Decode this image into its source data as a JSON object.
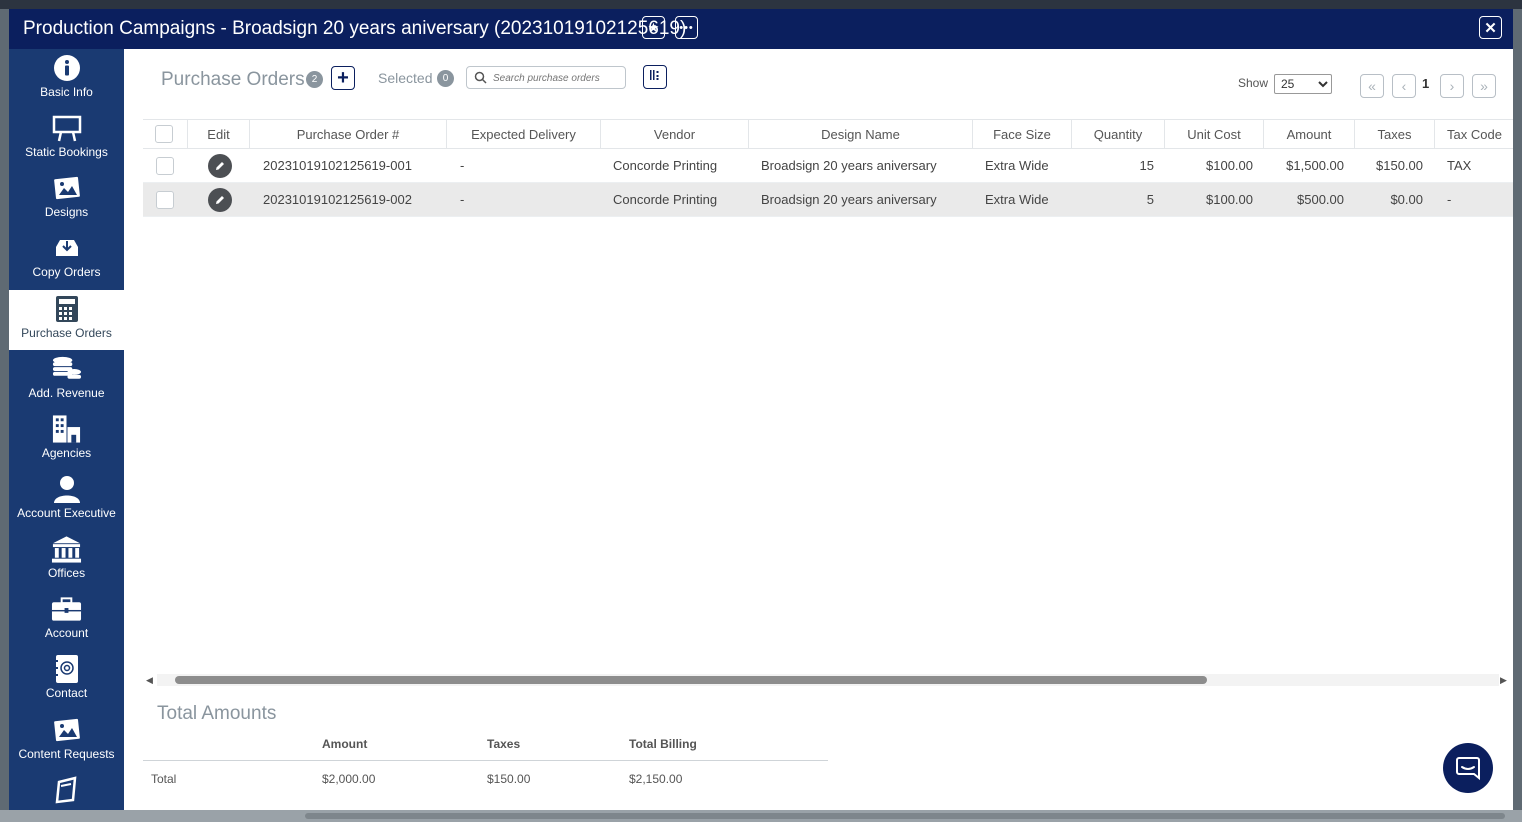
{
  "window": {
    "title": "Production Campaigns - Broadsign 20 years aniversary (20231019102125619)",
    "star_icon": "star-icon",
    "more_icon": "more-icon",
    "close_icon": "close-icon"
  },
  "sidebar": {
    "items": [
      {
        "label": "Basic Info",
        "icon": "info-icon",
        "active": false
      },
      {
        "label": "Static Bookings",
        "icon": "billboard-icon",
        "active": false
      },
      {
        "label": "Designs",
        "icon": "image-icon",
        "active": false
      },
      {
        "label": "Copy Orders",
        "icon": "inbox-download-icon",
        "active": false
      },
      {
        "label": "Purchase Orders",
        "icon": "calculator-icon",
        "active": true
      },
      {
        "label": "Add. Revenue",
        "icon": "coins-icon",
        "active": false
      },
      {
        "label": "Agencies",
        "icon": "building-icon",
        "active": false
      },
      {
        "label": "Account Executive",
        "icon": "user-icon",
        "active": false
      },
      {
        "label": "Offices",
        "icon": "bank-icon",
        "active": false
      },
      {
        "label": "Account",
        "icon": "briefcase-icon",
        "active": false
      },
      {
        "label": "Contact",
        "icon": "address-book-icon",
        "active": false
      },
      {
        "label": "Content Requests",
        "icon": "image-request-icon",
        "active": false
      },
      {
        "label": "",
        "icon": "document-icon",
        "active": false
      }
    ]
  },
  "toolbar": {
    "title": "Purchase Orders",
    "count": "2",
    "selected_label": "Selected",
    "selected_count": "0",
    "search_placeholder": "Search purchase orders",
    "show_label": "Show",
    "show_value": "25",
    "page": "1"
  },
  "table": {
    "columns": [
      "Edit",
      "Purchase Order #",
      "Expected Delivery",
      "Vendor",
      "Design Name",
      "Face Size",
      "Quantity",
      "Unit Cost",
      "Amount",
      "Taxes",
      "Tax Code"
    ],
    "rows": [
      {
        "po": "20231019102125619-001",
        "delivery": "-",
        "vendor": "Concorde Printing",
        "design": "Broadsign 20 years aniversary",
        "face_size": "Extra Wide",
        "quantity": "15",
        "unit_cost": "$100.00",
        "amount": "$1,500.00",
        "taxes": "$150.00",
        "tax_code": "TAX"
      },
      {
        "po": "20231019102125619-002",
        "delivery": "-",
        "vendor": "Concorde Printing",
        "design": "Broadsign 20 years aniversary",
        "face_size": "Extra Wide",
        "quantity": "5",
        "unit_cost": "$100.00",
        "amount": "$500.00",
        "taxes": "$0.00",
        "tax_code": "-"
      }
    ]
  },
  "totals": {
    "title": "Total Amounts",
    "headers": [
      "Amount",
      "Taxes",
      "Total Billing"
    ],
    "row_label": "Total",
    "amount": "$2,000.00",
    "taxes": "$150.00",
    "total_billing": "$2,150.00"
  },
  "colors": {
    "titlebar": "#0b1f5e",
    "sidebar": "#1a3a72",
    "accent": "#0b1f5e"
  }
}
